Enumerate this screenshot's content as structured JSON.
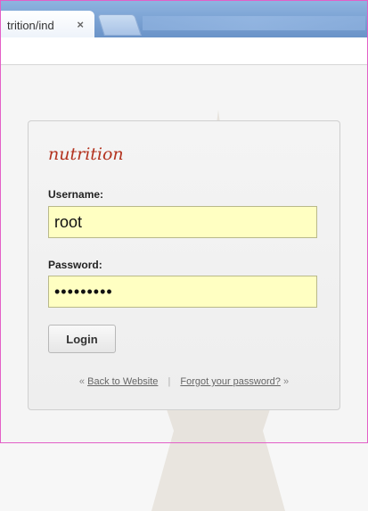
{
  "browser": {
    "tab_title": "trition/ind",
    "tab_close": "×"
  },
  "login": {
    "brand": "nutrition",
    "username_label": "Username:",
    "username_value": "root",
    "password_label": "Password:",
    "password_value": "•••••••••",
    "login_button": "Login",
    "back_prefix": "«",
    "back_link": "Back to Website",
    "separator": "|",
    "forgot_link": "Forgot your password?",
    "forgot_suffix": "»"
  },
  "colors": {
    "frame_border": "#e35fc7",
    "brand": "#b3331f",
    "input_bg": "#ffffc2"
  }
}
